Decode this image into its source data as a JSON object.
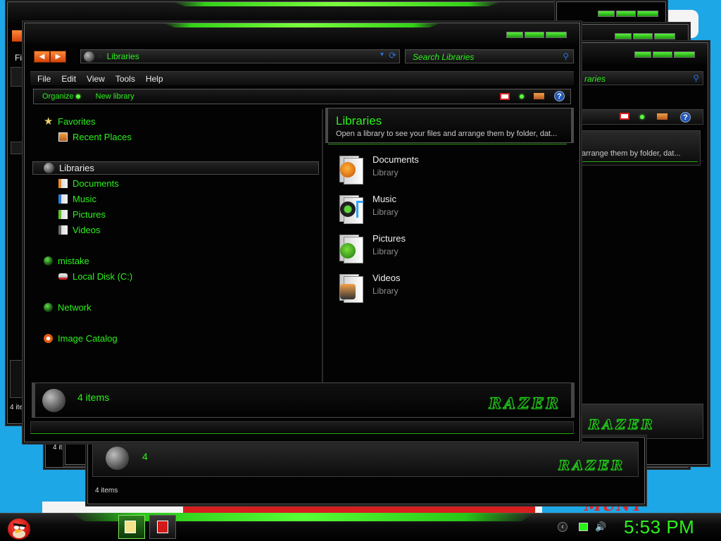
{
  "colors": {
    "desktop": "#1ea7e6",
    "accent_green": "#2cf21c",
    "window_bg": "#030303",
    "nav_orange": "#ff6a1a"
  },
  "background_windows": {
    "menu_fragment": "Fi",
    "search_fragment": "raries",
    "subtitle_fragment": "arrange them by folder, dat...",
    "count_label_a": "4 items",
    "count_label_b": "4 ite",
    "count_label_c": "4",
    "count_label_d": "4 items",
    "logo_text": "RAZER",
    "wallpaper_text": "MUNT"
  },
  "window": {
    "address": {
      "icon": "libraries-orb-icon",
      "path": "Libraries",
      "separator": "›",
      "dropdown_glyph": "▾",
      "refresh_glyph": "⟳"
    },
    "search": {
      "placeholder": "Search Libraries",
      "icon": "magnifier-icon",
      "glyph": "⚲"
    },
    "nav_buttons": {
      "back_glyph": "◀",
      "forward_glyph": "▶"
    },
    "menu": [
      "File",
      "Edit",
      "View",
      "Tools",
      "Help"
    ],
    "commands": {
      "organize": "Organize",
      "new_library": "New library"
    },
    "toolbar_icons": [
      "view-icon",
      "green-dot-icon",
      "preview-pane-icon",
      "help-icon"
    ],
    "help_glyph": "?",
    "nav_pane": {
      "favorites": {
        "label": "Favorites",
        "icon": "star-icon"
      },
      "recent_places": {
        "label": "Recent Places",
        "icon": "recent-places-icon"
      },
      "libraries": {
        "label": "Libraries",
        "icon": "libraries-orb-icon"
      },
      "documents": {
        "label": "Documents",
        "icon": "documents-icon"
      },
      "music": {
        "label": "Music",
        "icon": "music-icon"
      },
      "pictures": {
        "label": "Pictures",
        "icon": "pictures-icon"
      },
      "videos": {
        "label": "Videos",
        "icon": "videos-icon"
      },
      "homegroup": {
        "label": "mistake",
        "icon": "user-orb-icon"
      },
      "local_disk": {
        "label": "Local Disk (C:)",
        "icon": "disk-icon"
      },
      "network": {
        "label": "Network",
        "icon": "network-orb-icon"
      },
      "image_catalog": {
        "label": "Image Catalog",
        "icon": "image-catalog-icon"
      }
    },
    "content": {
      "title": "Libraries",
      "subtitle": "Open a library to see your files and arrange them by folder, dat...",
      "items": [
        {
          "name": "Documents",
          "type": "Library",
          "icon": "documents-library-icon"
        },
        {
          "name": "Music",
          "type": "Library",
          "icon": "music-library-icon"
        },
        {
          "name": "Pictures",
          "type": "Library",
          "icon": "pictures-library-icon"
        },
        {
          "name": "Videos",
          "type": "Library",
          "icon": "videos-library-icon"
        }
      ]
    },
    "status": {
      "count": "4 items",
      "logo_text": "RAZER"
    }
  },
  "taskbar": {
    "start_icon": "angry-bird-start-icon",
    "buttons": [
      {
        "name": "explorer-icon",
        "active": true
      },
      {
        "name": "pdf-icon",
        "active": false
      }
    ],
    "tray_icons": [
      "tray-arrow-icon",
      "tray-battery-icon",
      "volume-icon"
    ],
    "tray_arrow_glyph": "‹",
    "volume_glyph": "🔊",
    "clock": "5:53 PM"
  }
}
